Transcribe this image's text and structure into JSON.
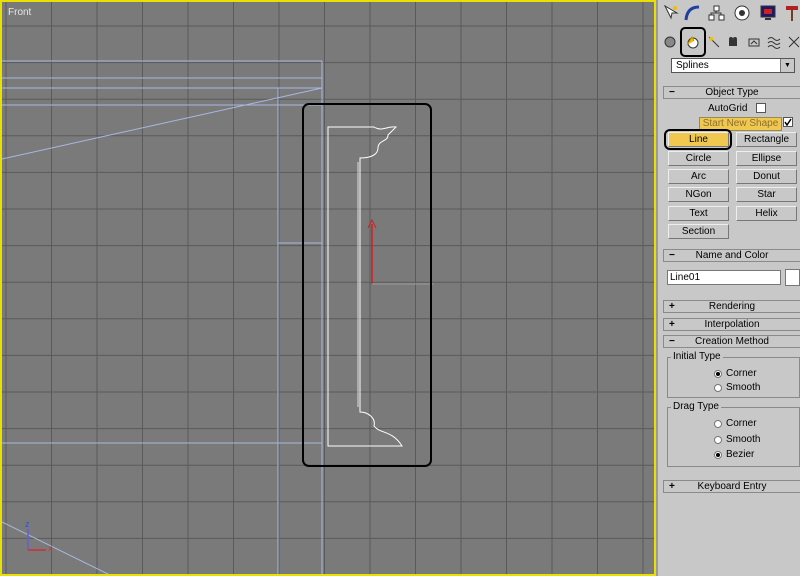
{
  "viewport": {
    "label": "Front"
  },
  "command_panel": {
    "tabs": [
      {
        "name": "create-tab",
        "icon": "cursor-star-icon"
      },
      {
        "name": "modify-tab",
        "icon": "bend-icon"
      },
      {
        "name": "hierarchy-tab",
        "icon": "hierarchy-icon"
      },
      {
        "name": "motion-tab",
        "icon": "motion-icon"
      },
      {
        "name": "display-tab",
        "icon": "monitor-icon"
      },
      {
        "name": "utilities-tab",
        "icon": "hammer-icon"
      }
    ],
    "category_dropdown": "Splines",
    "object_type": {
      "title": "Object Type",
      "autogrid": "AutoGrid",
      "start_new_shape": "Start New Shape",
      "buttons": [
        "Line",
        "Rectangle",
        "Circle",
        "Ellipse",
        "Arc",
        "Donut",
        "NGon",
        "Star",
        "Text",
        "Helix",
        "Section"
      ]
    },
    "name_and_color": {
      "title": "Name and Color",
      "name": "Line01"
    },
    "rendering": {
      "title": "Rendering"
    },
    "interpolation": {
      "title": "Interpolation"
    },
    "creation_method": {
      "title": "Creation Method",
      "initial_type": {
        "title": "Initial Type",
        "options": [
          "Corner",
          "Smooth"
        ],
        "selected": "Corner"
      },
      "drag_type": {
        "title": "Drag Type",
        "options": [
          "Corner",
          "Smooth",
          "Bezier"
        ],
        "selected": "Bezier"
      }
    },
    "keyboard_entry": {
      "title": "Keyboard Entry"
    }
  },
  "axis": {
    "z": "z",
    "x": "x"
  }
}
